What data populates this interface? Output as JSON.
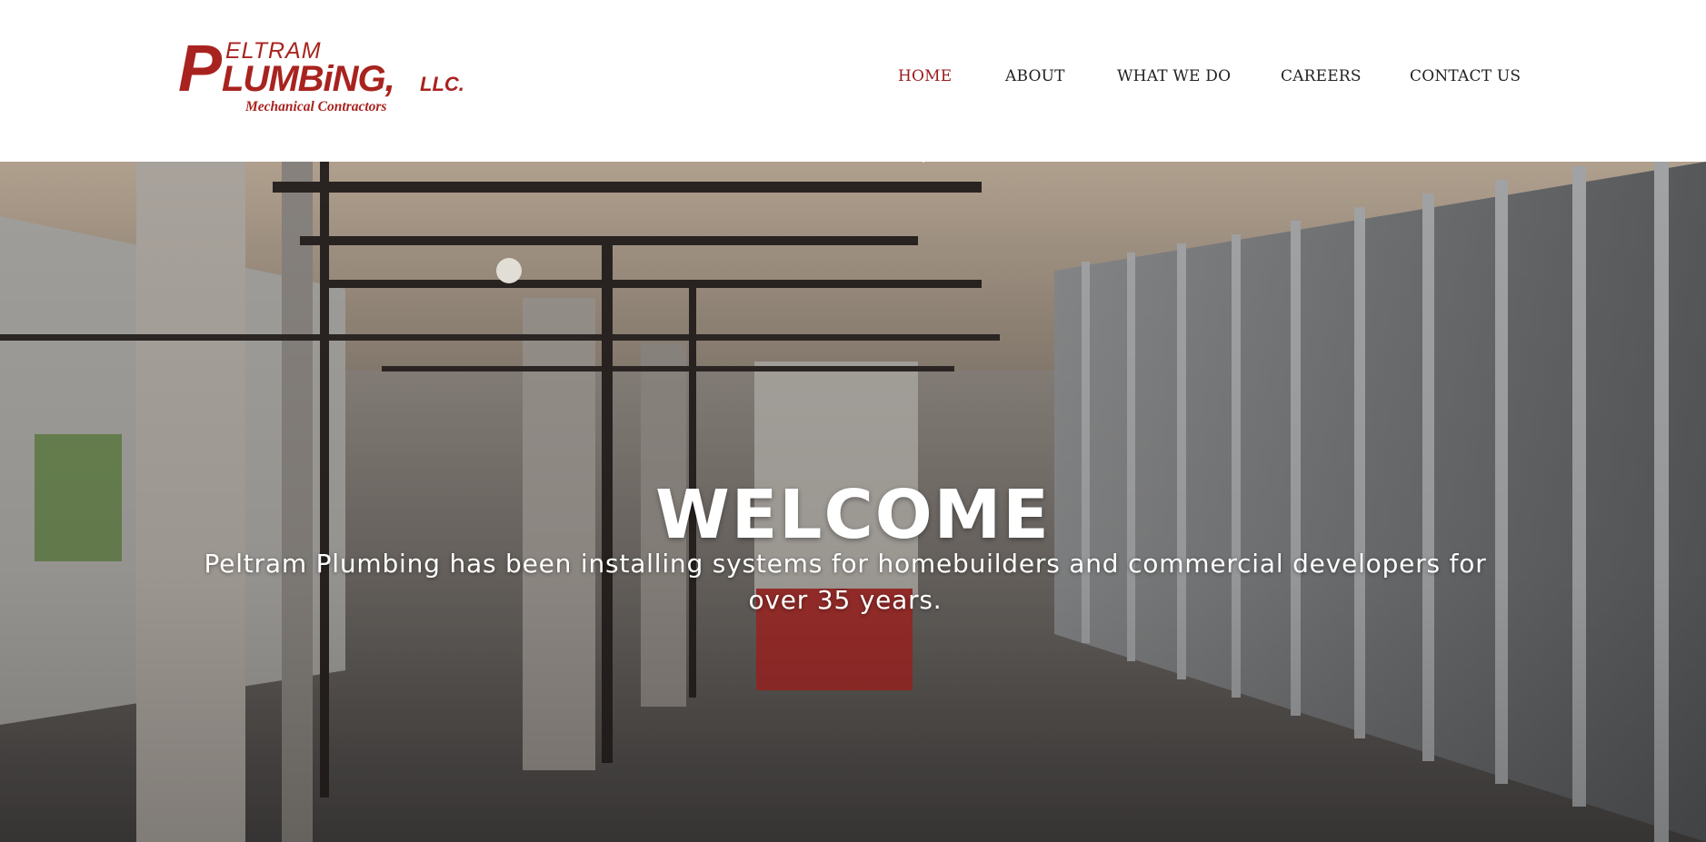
{
  "logo": {
    "line1": "ELTRAM",
    "big_p": "P",
    "line2": "LUMBiNG,",
    "suffix": "LLC.",
    "tagline": "Mechanical Contractors",
    "brand_color": "#a8231f"
  },
  "nav": {
    "items": [
      {
        "label": "HOME",
        "active": true
      },
      {
        "label": "ABOUT",
        "active": false
      },
      {
        "label": "WHAT WE DO",
        "active": false
      },
      {
        "label": "CAREERS",
        "active": false
      },
      {
        "label": "CONTACT US",
        "active": false
      }
    ],
    "active_color": "#9b1b1b",
    "text_color": "#222222"
  },
  "hero": {
    "title": "WELCOME",
    "subtitle": "Peltram Plumbing has been installing systems for homebuilders and commercial developers for over 35 years.",
    "background_icon": "construction-photo"
  }
}
